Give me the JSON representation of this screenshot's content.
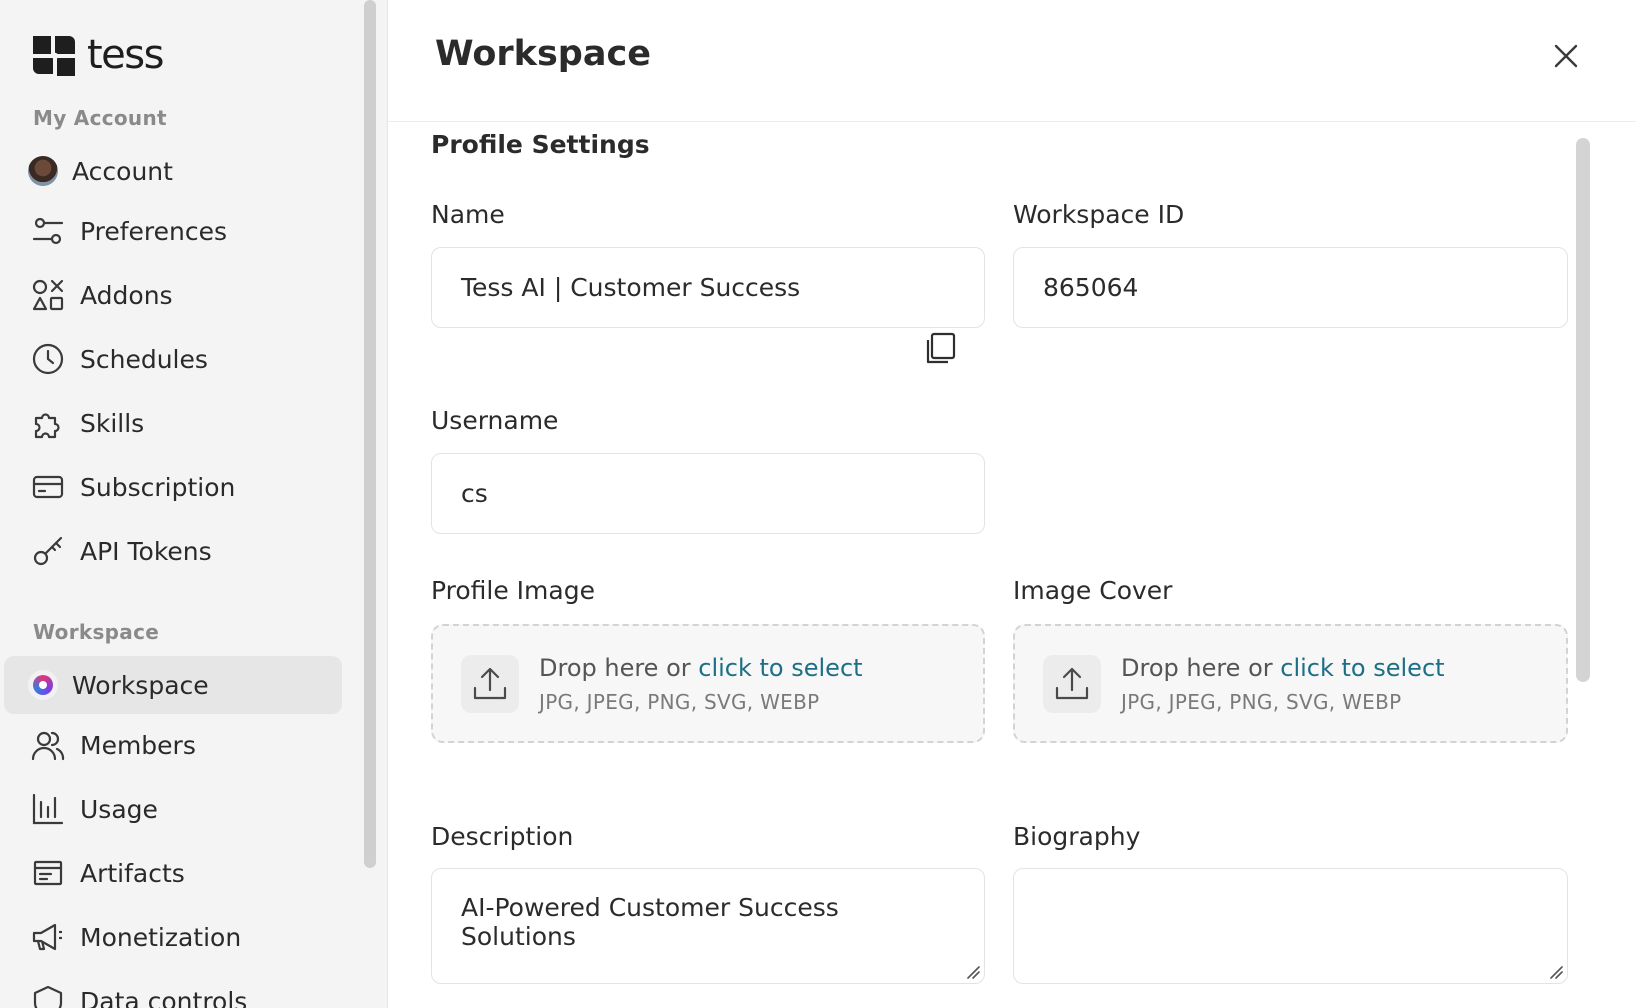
{
  "brand": {
    "name": "tess"
  },
  "sidebar": {
    "my_account_label": "My Account",
    "workspace_label": "Workspace",
    "account_items": [
      {
        "label": "Account",
        "icon": "user-avatar"
      },
      {
        "label": "Preferences",
        "icon": "sliders-icon"
      },
      {
        "label": "Addons",
        "icon": "shapes-icon"
      },
      {
        "label": "Schedules",
        "icon": "clock-icon"
      },
      {
        "label": "Skills",
        "icon": "puzzle-icon"
      },
      {
        "label": "Subscription",
        "icon": "credit-card-icon"
      },
      {
        "label": "API Tokens",
        "icon": "key-icon"
      }
    ],
    "workspace_items": [
      {
        "label": "Workspace",
        "icon": "workspace-avatar",
        "active": true
      },
      {
        "label": "Members",
        "icon": "users-icon"
      },
      {
        "label": "Usage",
        "icon": "bar-chart-icon"
      },
      {
        "label": "Artifacts",
        "icon": "artifact-icon"
      },
      {
        "label": "Monetization",
        "icon": "megaphone-icon"
      },
      {
        "label": "Data controls",
        "icon": "shield-icon"
      }
    ]
  },
  "main": {
    "title": "Workspace",
    "section_title": "Profile Settings",
    "name": {
      "label": "Name",
      "value": "Tess AI | Customer Success"
    },
    "workspace_id": {
      "label": "Workspace ID",
      "value": "865064"
    },
    "username": {
      "label": "Username",
      "value": "cs"
    },
    "profile_image": {
      "label": "Profile Image",
      "drop_text": "Drop here or ",
      "link_text": "click to select",
      "formats": "JPG, JPEG, PNG, SVG, WEBP"
    },
    "image_cover": {
      "label": "Image Cover",
      "drop_text": "Drop here or ",
      "link_text": "click to select",
      "formats": "JPG, JPEG, PNG, SVG, WEBP"
    },
    "description": {
      "label": "Description",
      "value": "AI-Powered Customer Success Solutions"
    },
    "biography": {
      "label": "Biography",
      "value": ""
    }
  },
  "colors": {
    "link": "#1c6f86",
    "sidebar_bg": "#f4f4f4",
    "active_item_bg": "#e6e6e6"
  }
}
